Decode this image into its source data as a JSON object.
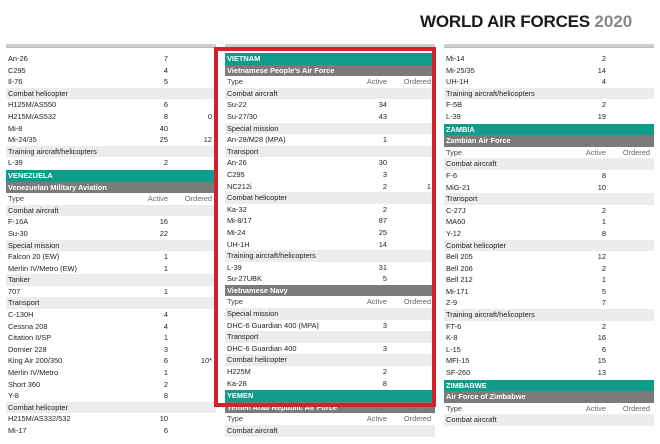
{
  "header": {
    "title_main": "WORLD AIR FORCES",
    "title_year": "2020"
  },
  "colors": {
    "country_bar": "#0f9c8a",
    "force_bar": "#7b7b7b",
    "category_bg": "#ececec",
    "highlight_border": "#d4222a"
  },
  "col1": [
    {
      "k": "row",
      "name": "An-26",
      "a": "7",
      "o": ""
    },
    {
      "k": "row",
      "name": "C295",
      "a": "4",
      "o": ""
    },
    {
      "k": "row",
      "name": "Il-76",
      "a": "5",
      "o": ""
    },
    {
      "k": "cat",
      "name": "Combat helicopter"
    },
    {
      "k": "row",
      "name": "H125M/AS550",
      "a": "6",
      "o": ""
    },
    {
      "k": "row",
      "name": "H215M/AS532",
      "a": "8",
      "o": "0"
    },
    {
      "k": "row",
      "name": "Mi-8",
      "a": "40",
      "o": ""
    },
    {
      "k": "row",
      "name": "Mi-24/35",
      "a": "25",
      "o": "12"
    },
    {
      "k": "cat",
      "name": "Training aircraft/helicopters"
    },
    {
      "k": "row",
      "name": "L-39",
      "a": "2",
      "o": ""
    },
    {
      "k": "country",
      "name": "VENEZUELA"
    },
    {
      "k": "force",
      "name": "Venezuelan Military Aviation"
    },
    {
      "k": "hdr",
      "name": "Type",
      "a": "Active",
      "o": "Ordered"
    },
    {
      "k": "cat",
      "name": "Combat aircraft"
    },
    {
      "k": "row",
      "name": "F-16A",
      "a": "16",
      "o": ""
    },
    {
      "k": "row",
      "name": "Su-30",
      "a": "22",
      "o": ""
    },
    {
      "k": "cat",
      "name": "Special mission"
    },
    {
      "k": "row",
      "name": "Falcon 20 (EW)",
      "a": "1",
      "o": ""
    },
    {
      "k": "row",
      "name": "Merlin IV/Metro (EW)",
      "a": "1",
      "o": ""
    },
    {
      "k": "cat",
      "name": "Tanker"
    },
    {
      "k": "row",
      "name": "707",
      "a": "1",
      "o": ""
    },
    {
      "k": "cat",
      "name": "Transport"
    },
    {
      "k": "row",
      "name": "C-130H",
      "a": "4",
      "o": ""
    },
    {
      "k": "row",
      "name": "Cessna 208",
      "a": "4",
      "o": ""
    },
    {
      "k": "row",
      "name": "Citation II/SP",
      "a": "1",
      "o": ""
    },
    {
      "k": "row",
      "name": "Dornier 228",
      "a": "3",
      "o": ""
    },
    {
      "k": "row",
      "name": "King Air 200/350",
      "a": "6",
      "o": "10*"
    },
    {
      "k": "row",
      "name": "Merlin IV/Metro",
      "a": "1",
      "o": ""
    },
    {
      "k": "row",
      "name": "Short 360",
      "a": "2",
      "o": ""
    },
    {
      "k": "row",
      "name": "Y-8",
      "a": "8",
      "o": ""
    },
    {
      "k": "cat",
      "name": "Combat helicopter"
    },
    {
      "k": "row",
      "name": "H215M/AS332/532",
      "a": "10",
      "o": ""
    },
    {
      "k": "row",
      "name": "Mi-17",
      "a": "6",
      "o": ""
    }
  ],
  "col2": [
    {
      "k": "country",
      "name": "VIETNAM"
    },
    {
      "k": "force",
      "name": "Vietnamese People's Air Force"
    },
    {
      "k": "hdr",
      "name": "Type",
      "a": "Active",
      "o": "Ordered"
    },
    {
      "k": "cat",
      "name": "Combat aircraft"
    },
    {
      "k": "row",
      "name": "Su-22",
      "a": "34",
      "o": ""
    },
    {
      "k": "row",
      "name": "Su-27/30",
      "a": "43",
      "o": ""
    },
    {
      "k": "cat",
      "name": "Special mission"
    },
    {
      "k": "row",
      "name": "An-28/M28 (MPA)",
      "a": "1",
      "o": ""
    },
    {
      "k": "cat",
      "name": "Transport"
    },
    {
      "k": "row",
      "name": "An-26",
      "a": "30",
      "o": ""
    },
    {
      "k": "row",
      "name": "C295",
      "a": "3",
      "o": ""
    },
    {
      "k": "row",
      "name": "NC212i",
      "a": "2",
      "o": "1"
    },
    {
      "k": "cat",
      "name": "Combat helicopter"
    },
    {
      "k": "row",
      "name": "Ka-32",
      "a": "2",
      "o": ""
    },
    {
      "k": "row",
      "name": "Mi-8/17",
      "a": "87",
      "o": ""
    },
    {
      "k": "row",
      "name": "Mi-24",
      "a": "25",
      "o": ""
    },
    {
      "k": "row",
      "name": "UH-1H",
      "a": "14",
      "o": ""
    },
    {
      "k": "cat",
      "name": "Training aircraft/helicopters"
    },
    {
      "k": "row",
      "name": "L-39",
      "a": "31",
      "o": ""
    },
    {
      "k": "row",
      "name": "Su-27UBK",
      "a": "5",
      "o": ""
    },
    {
      "k": "force",
      "name": "Vietnamese Navy"
    },
    {
      "k": "hdr",
      "name": "Type",
      "a": "Active",
      "o": "Ordered"
    },
    {
      "k": "cat",
      "name": "Special mission"
    },
    {
      "k": "row",
      "name": "DHC-6 Guardian 400 (MPA)",
      "a": "3",
      "o": ""
    },
    {
      "k": "cat",
      "name": "Transport"
    },
    {
      "k": "row",
      "name": "DHC-6 Guardian 400",
      "a": "3",
      "o": ""
    },
    {
      "k": "cat",
      "name": "Combat helicopter"
    },
    {
      "k": "row",
      "name": "H225M",
      "a": "2",
      "o": ""
    },
    {
      "k": "row",
      "name": "Ka-28",
      "a": "8",
      "o": ""
    },
    {
      "k": "country",
      "name": "YEMEN"
    },
    {
      "k": "force",
      "name": "Yemen Arab Republic Air Force"
    },
    {
      "k": "hdr",
      "name": "Type",
      "a": "Active",
      "o": "Ordered"
    },
    {
      "k": "cat",
      "name": "Combat aircraft"
    }
  ],
  "col3": [
    {
      "k": "row",
      "name": "Mi-14",
      "a": "2",
      "o": ""
    },
    {
      "k": "row",
      "name": "Mi-25/35",
      "a": "14",
      "o": ""
    },
    {
      "k": "row",
      "name": "UH-1H",
      "a": "4",
      "o": ""
    },
    {
      "k": "cat",
      "name": "Training aircraft/helicopters"
    },
    {
      "k": "row",
      "name": "F-5B",
      "a": "2",
      "o": ""
    },
    {
      "k": "row",
      "name": "L-39",
      "a": "19",
      "o": ""
    },
    {
      "k": "country",
      "name": "ZAMBIA"
    },
    {
      "k": "force",
      "name": "Zambian Air Force"
    },
    {
      "k": "hdr",
      "name": "Type",
      "a": "Active",
      "o": "Ordered"
    },
    {
      "k": "cat",
      "name": "Combat aircraft"
    },
    {
      "k": "row",
      "name": "F-6",
      "a": "8",
      "o": ""
    },
    {
      "k": "row",
      "name": "MiG-21",
      "a": "10",
      "o": ""
    },
    {
      "k": "cat",
      "name": "Transport"
    },
    {
      "k": "row",
      "name": "C-27J",
      "a": "2",
      "o": ""
    },
    {
      "k": "row",
      "name": "MA60",
      "a": "1",
      "o": ""
    },
    {
      "k": "row",
      "name": "Y-12",
      "a": "8",
      "o": ""
    },
    {
      "k": "cat",
      "name": "Combat helicopter"
    },
    {
      "k": "row",
      "name": "Bell 205",
      "a": "12",
      "o": ""
    },
    {
      "k": "row",
      "name": "Bell 206",
      "a": "2",
      "o": ""
    },
    {
      "k": "row",
      "name": "Bell 212",
      "a": "1",
      "o": ""
    },
    {
      "k": "row",
      "name": "Mi-171",
      "a": "5",
      "o": ""
    },
    {
      "k": "row",
      "name": "Z-9",
      "a": "7",
      "o": ""
    },
    {
      "k": "cat",
      "name": "Training aircraft/helicopters"
    },
    {
      "k": "row",
      "name": "FT-6",
      "a": "2",
      "o": ""
    },
    {
      "k": "row",
      "name": "K-8",
      "a": "16",
      "o": ""
    },
    {
      "k": "row",
      "name": "L-15",
      "a": "6",
      "o": ""
    },
    {
      "k": "row",
      "name": "MFI-15",
      "a": "15",
      "o": ""
    },
    {
      "k": "row",
      "name": "SF-260",
      "a": "13",
      "o": ""
    },
    {
      "k": "country",
      "name": "ZIMBABWE"
    },
    {
      "k": "force",
      "name": "Air Force of Zimbabwe"
    },
    {
      "k": "hdr",
      "name": "Type",
      "a": "Active",
      "o": "Ordered"
    },
    {
      "k": "cat",
      "name": "Combat aircraft"
    }
  ]
}
